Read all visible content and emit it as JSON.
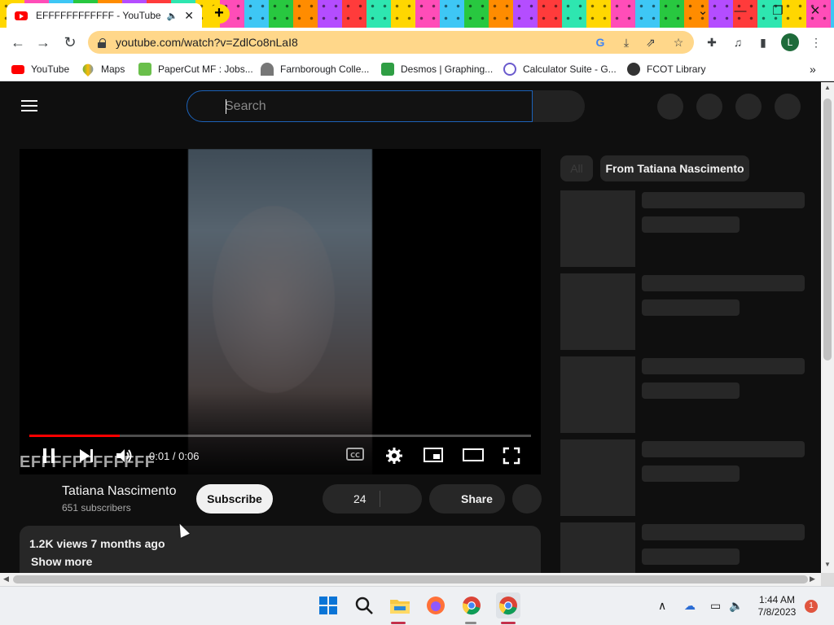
{
  "browser": {
    "tab": {
      "title": "EFFFFFFFFFFFF - YouTube",
      "audio_icon": "speaker-icon",
      "close": "✕"
    },
    "new_tab": "+",
    "window_controls": {
      "minimize": "—",
      "restore": "❐",
      "close": "✕",
      "tab_search": "⌄"
    },
    "url": "youtube.com/watch?v=ZdlCo8nLaI8",
    "profile_initial": "L",
    "bookmarks": [
      {
        "label": "YouTube",
        "icon": "youtube-icon",
        "color": "#ff0000"
      },
      {
        "label": "Maps",
        "icon": "maps-icon",
        "color": "#34a853"
      },
      {
        "label": "PaperCut MF : Jobs...",
        "icon": "papercut-icon",
        "color": "#6abf4b"
      },
      {
        "label": "Farnborough Colle...",
        "icon": "college-icon",
        "color": "#555555"
      },
      {
        "label": "Desmos | Graphing...",
        "icon": "desmos-icon",
        "color": "#2f9e44"
      },
      {
        "label": "Calculator Suite - G...",
        "icon": "geogebra-icon",
        "color": "#6a5acd"
      },
      {
        "label": "FCOT Library",
        "icon": "globe-icon",
        "color": "#333333"
      }
    ],
    "bookmarks_overflow": "»"
  },
  "youtube": {
    "search_placeholder": "Search",
    "player": {
      "current_time": "0:01",
      "duration": "0:06",
      "time_display": "0:01 / 0:06",
      "progress_fraction": 0.18,
      "watermark": "EFFFFFFFFFFFF"
    },
    "channel": {
      "name": "Tatiana Nascimento",
      "subscribers": "651 subscribers",
      "subscribe_label": "Subscribe"
    },
    "actions": {
      "likes": "24",
      "share": "Share"
    },
    "description": {
      "meta": "1.2K views  7 months ago",
      "show_more": "Show more"
    },
    "chips": [
      "All",
      "From Tatiana Nascimento"
    ]
  },
  "taskbar": {
    "clock_time": "1:44 AM",
    "clock_date": "7/8/2023",
    "notification_count": "1"
  },
  "colors": {
    "accent_red": "#ff0000",
    "search_border": "#1c62b9",
    "omnibox": "#ffd78a"
  }
}
